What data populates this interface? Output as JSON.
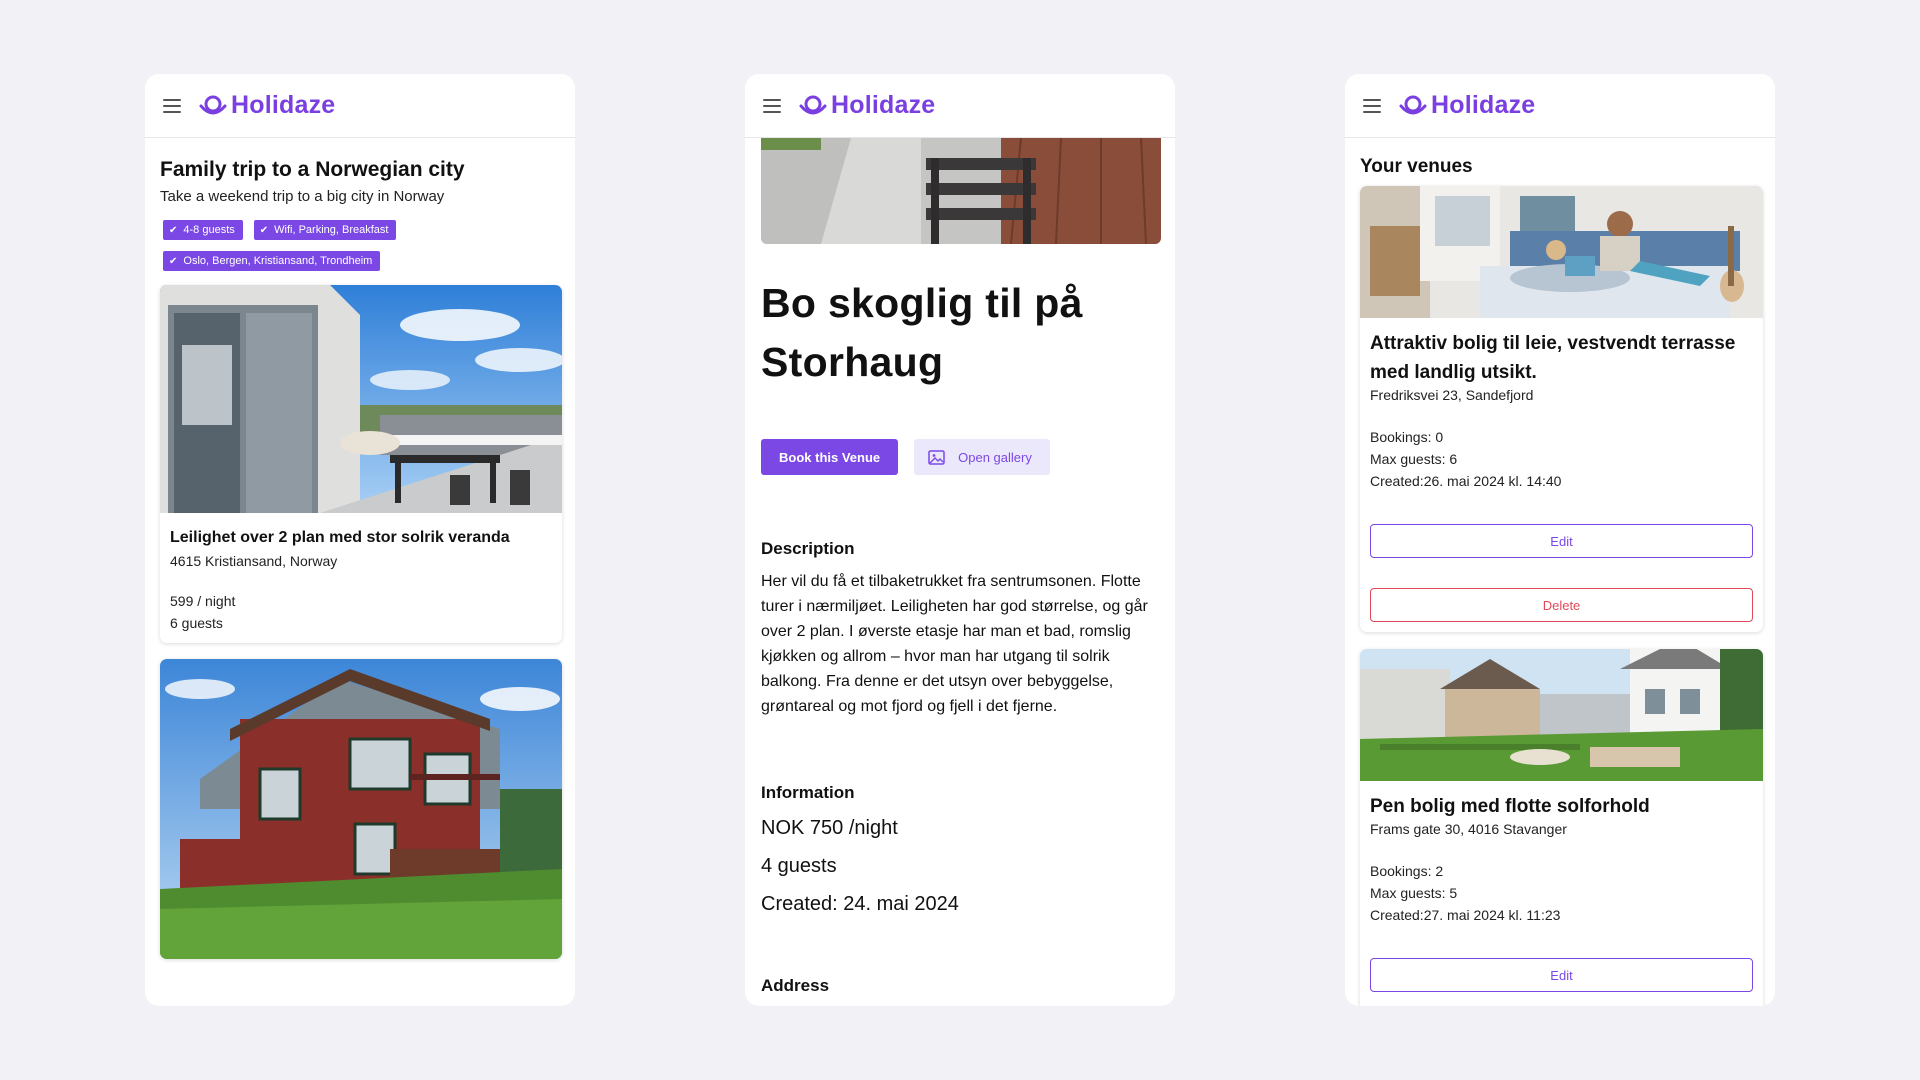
{
  "brand": {
    "name": "Holidaze",
    "accent": "#7b48e6",
    "danger": "#e04a5a"
  },
  "screen1": {
    "title": "Family trip to a Norwegian city",
    "subtitle": "Take a weekend trip to a big city in Norway",
    "tags": [
      "4-8 guests",
      "Wifi, Parking, Breakfast",
      "Oslo, Bergen, Kristiansand, Trondheim"
    ],
    "listing": {
      "title": "Leilighet over 2 plan med stor solrik veranda",
      "address": "4615 Kristiansand, Norway",
      "price": "599 / night",
      "guests": "6 guests"
    }
  },
  "screen2": {
    "title": "Bo skoglig til på Storhaug",
    "book_label": "Book this Venue",
    "gallery_label": "Open gallery",
    "description_heading": "Description",
    "description": "Her vil du få et tilbaketrukket fra sentrumsonen. Flotte turer i nærmiljøet. Leiligheten har god størrelse, og går over 2 plan. I øverste etasje har man et bad, romslig kjøkken og allrom – hvor man har utgang til solrik balkong. Fra denne er det utsyn over bebyggelse, grøntareal og mot fjord og fjell i det fjerne.",
    "information_heading": "Information",
    "price": "NOK 750 /night",
    "guests": "4 guests",
    "created": "Created: 24. mai 2024",
    "next_heading": "Address"
  },
  "screen3": {
    "title": "Your venues",
    "venues": [
      {
        "title": "Attraktiv bolig til leie, vestvendt terrasse med landlig utsikt.",
        "address": "Fredriksvei 23, Sandefjord",
        "bookings": "Bookings: 0",
        "max_guests": "Max guests: 6",
        "created": "Created:26. mai 2024 kl. 14:40",
        "edit_label": "Edit",
        "delete_label": "Delete"
      },
      {
        "title": "Pen bolig med flotte solforhold",
        "address": "Frams gate 30, 4016 Stavanger",
        "bookings": "Bookings: 2",
        "max_guests": "Max guests: 5",
        "created": "Created:27. mai 2024 kl. 11:23",
        "edit_label": "Edit"
      }
    ]
  }
}
